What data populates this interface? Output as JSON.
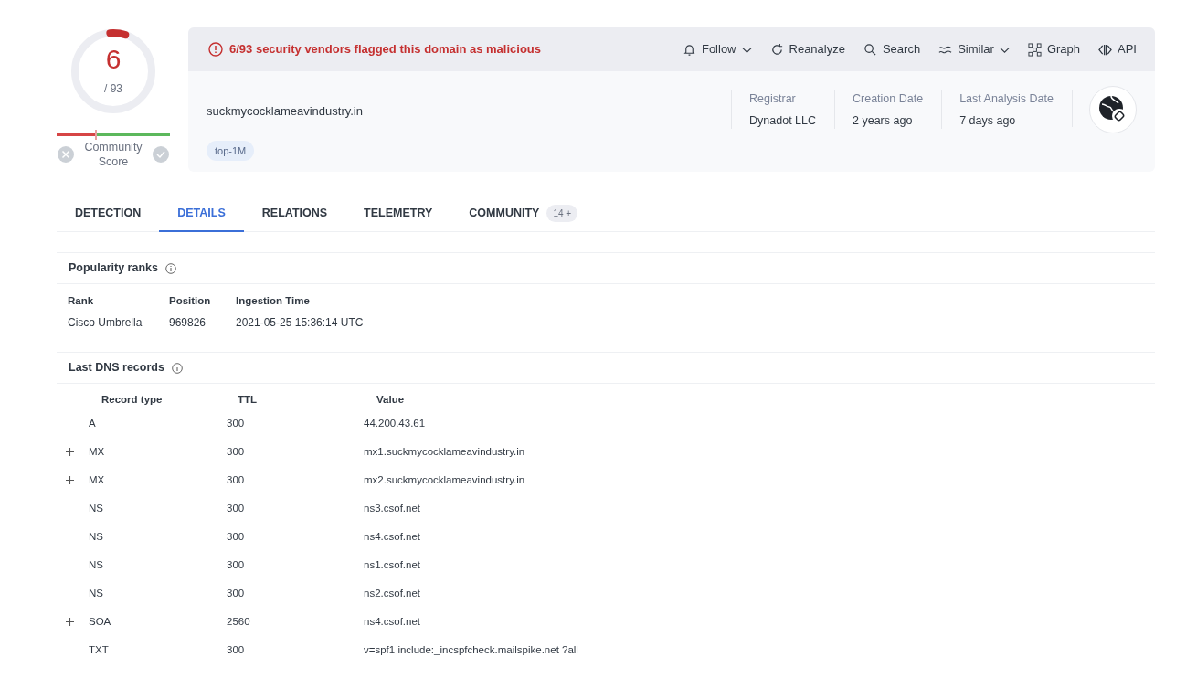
{
  "score": {
    "value": "6",
    "total": "/ 93",
    "level": 0.065
  },
  "community": {
    "label": "Community Score",
    "level": 0.35
  },
  "alert": {
    "text": "6/93 security vendors flagged this domain as malicious"
  },
  "actions": [
    {
      "label": "Follow",
      "kind": "bell",
      "dropdown": true
    },
    {
      "label": "Reanalyze",
      "kind": "reload",
      "dropdown": false
    },
    {
      "label": "Search",
      "kind": "search",
      "dropdown": false
    },
    {
      "label": "Similar",
      "kind": "similar",
      "dropdown": true
    },
    {
      "label": "Graph",
      "kind": "graph",
      "dropdown": false
    },
    {
      "label": "API",
      "kind": "api",
      "dropdown": false
    }
  ],
  "domain": "suckmycocklameavindustry.in",
  "tags": [
    "top-1M"
  ],
  "facts": [
    {
      "label": "Registrar",
      "value": "Dynadot LLC"
    },
    {
      "label": "Creation Date",
      "value": "2 years ago"
    },
    {
      "label": "Last Analysis Date",
      "value": "7 days ago"
    }
  ],
  "tabs": [
    {
      "label": "DETECTION",
      "selected": false
    },
    {
      "label": "DETAILS",
      "selected": true
    },
    {
      "label": "RELATIONS",
      "selected": false
    },
    {
      "label": "TELEMETRY",
      "selected": false
    },
    {
      "label": "COMMUNITY",
      "selected": false,
      "badge": "14 +"
    }
  ],
  "popularity": {
    "title": "Popularity ranks",
    "columns": [
      "Rank",
      "Position",
      "Ingestion Time"
    ],
    "rows": [
      [
        "Cisco Umbrella",
        "969826",
        "2021-05-25 15:36:14 UTC"
      ]
    ]
  },
  "dns": {
    "title": "Last DNS records",
    "columns": [
      "Record type",
      "TTL",
      "Value"
    ],
    "rows": [
      {
        "expandable": false,
        "cells": [
          "A",
          "300",
          "44.200.43.61"
        ]
      },
      {
        "expandable": true,
        "cells": [
          "MX",
          "300",
          "mx1.suckmycocklameavindustry.in"
        ]
      },
      {
        "expandable": true,
        "cells": [
          "MX",
          "300",
          "mx2.suckmycocklameavindustry.in"
        ]
      },
      {
        "expandable": false,
        "cells": [
          "NS",
          "300",
          "ns3.csof.net"
        ]
      },
      {
        "expandable": false,
        "cells": [
          "NS",
          "300",
          "ns4.csof.net"
        ]
      },
      {
        "expandable": false,
        "cells": [
          "NS",
          "300",
          "ns1.csof.net"
        ]
      },
      {
        "expandable": false,
        "cells": [
          "NS",
          "300",
          "ns2.csof.net"
        ]
      },
      {
        "expandable": true,
        "cells": [
          "SOA",
          "2560",
          "ns4.csof.net"
        ]
      },
      {
        "expandable": false,
        "cells": [
          "TXT",
          "300",
          "v=spf1 include:_incspfcheck.mailspike.net ?all"
        ]
      }
    ]
  }
}
